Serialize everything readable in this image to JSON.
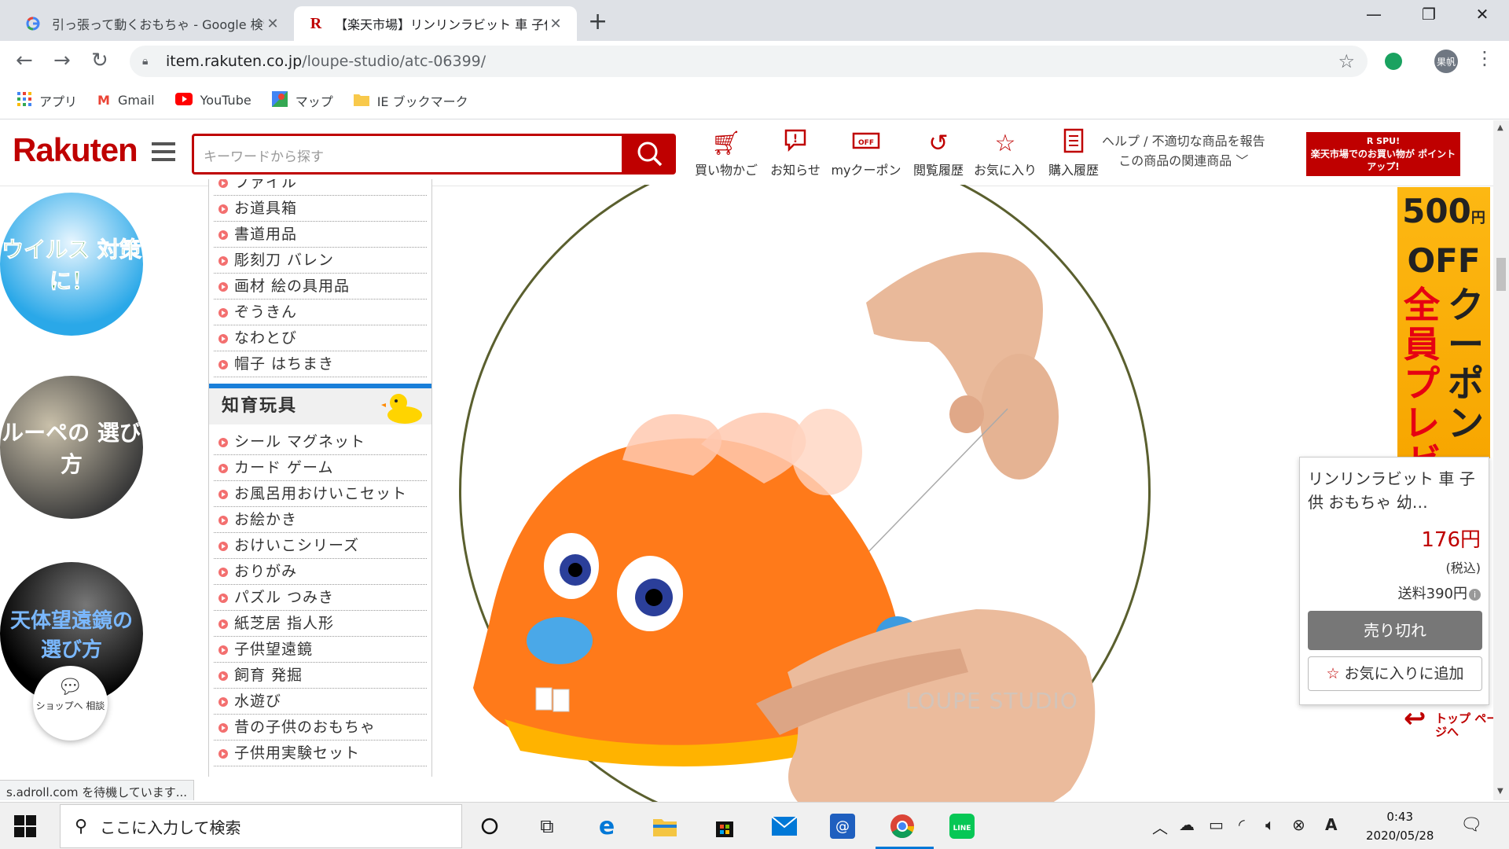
{
  "browser": {
    "tabs": [
      {
        "title": "引っ張って動くおもちゃ - Google 検索",
        "favicon": "google-icon"
      },
      {
        "title": "【楽天市場】リンリンラビット 車 子供",
        "favicon": "rakuten-icon"
      }
    ],
    "url_host": "item.rakuten.co.jp",
    "url_path": "/loupe-studio/atc-06399/",
    "profile": "果帆",
    "bookmarks": [
      "アプリ",
      "Gmail",
      "YouTube",
      "マップ",
      "IE ブックマーク"
    ]
  },
  "header": {
    "logo": "Rakuten",
    "search_placeholder": "キーワードから探す",
    "nav": [
      "買い物かご",
      "お知らせ",
      "myクーポン",
      "閲覧履歴",
      "お気に入り",
      "購入履歴"
    ],
    "help_line1": "ヘルプ / 不適切な商品を報告",
    "help_line2": "この商品の関連商品",
    "spu_title": "R SPU!",
    "spu_text": "楽天市場でのお買い物が ポイントアップ!"
  },
  "banners": {
    "b1": "ウイルス 対策に！",
    "b2": "ルーペの 選び方",
    "b3": "天体望遠鏡の 選び方",
    "chat": "ショップへ 相談"
  },
  "sidebar": {
    "items_top": [
      "ファイル",
      "お道具箱",
      "書道用品",
      "彫刻刀 バレン",
      "画材 絵の具用品",
      "ぞうきん",
      "なわとび",
      "帽子 はちまき"
    ],
    "section": "知育玩具",
    "items_bottom": [
      "シール マグネット",
      "カード ゲーム",
      "お風呂用おけいこセット",
      "お絵かき",
      "おけいこシリーズ",
      "おりがみ",
      "パズル つみき",
      "紙芝居 指人形",
      "子供望遠鏡",
      "飼育 発掘",
      "水遊び",
      "昔の子供のおもちゃ",
      "子供用実験セット"
    ]
  },
  "product": {
    "watermark": "LOUPE STUDIO"
  },
  "ad": {
    "amount": "500",
    "unit": "円",
    "off": "OFF",
    "col1": "全員プレゼ",
    "col2": "クーポン"
  },
  "card": {
    "name": "リンリンラビット 車 子供 おもちゃ 幼…",
    "price": "176円",
    "tax": "(税込)",
    "shipping": "送料390円",
    "soldout": "売り切れ",
    "favorite": "お気に入りに追加"
  },
  "totop": "トップ ページへ",
  "status": "s.adroll.com を待機しています...",
  "taskbar": {
    "search": "ここに入力して検索",
    "time": "0:43",
    "date": "2020/05/28"
  },
  "colors": {
    "brand": "#bf0000",
    "accent_blue": "#1a7fd9",
    "rabbit": "#ff7a1a"
  }
}
